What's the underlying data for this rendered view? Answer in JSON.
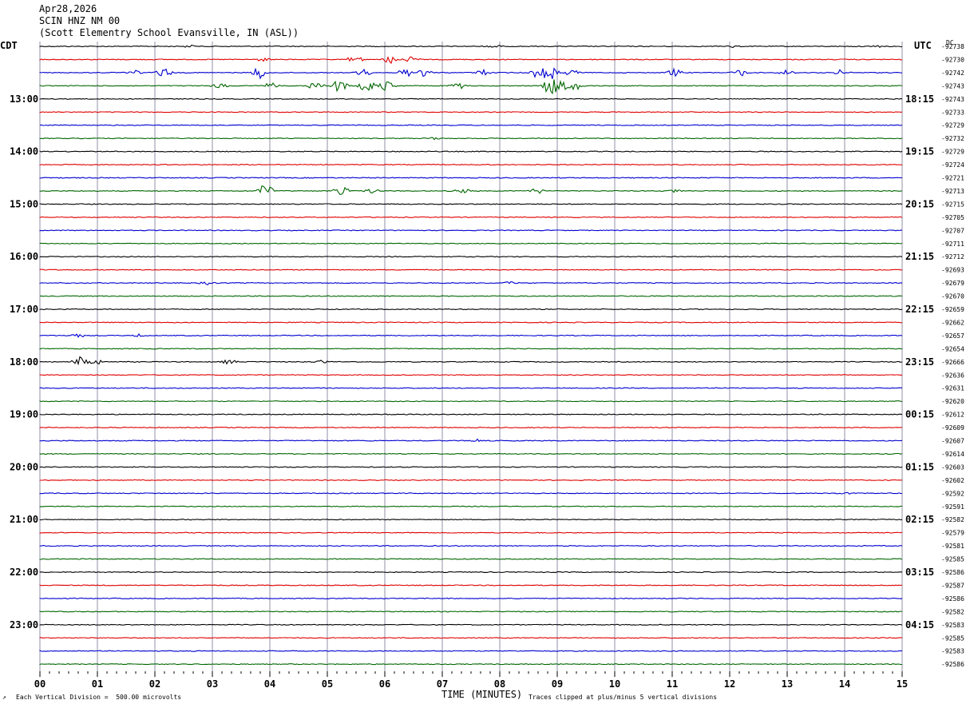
{
  "header": {
    "date": "Apr28,2026",
    "station": "SCIN HNZ NM 00",
    "location": "(Scott Elementry School Evansville, IN (ASL))"
  },
  "chart_data": {
    "type": "line",
    "left_zone_label": "CDT",
    "right_zone_label": "UTC",
    "dc_label": "DC",
    "xlabel": "TIME (MINUTES)",
    "x_ticks": [
      "00",
      "01",
      "02",
      "03",
      "04",
      "05",
      "06",
      "07",
      "08",
      "09",
      "10",
      "11",
      "12",
      "13",
      "14",
      "15"
    ],
    "left_hour_labels": [
      "13:00",
      "14:00",
      "15:00",
      "16:00",
      "17:00",
      "18:00",
      "19:00",
      "20:00",
      "21:00",
      "22:00",
      "23:00"
    ],
    "right_hour_labels": [
      "18:15",
      "19:15",
      "20:15",
      "21:15",
      "22:15",
      "23:15",
      "00:15",
      "01:15",
      "02:15",
      "03:15",
      "04:15"
    ],
    "trace_colors": [
      "#000000",
      "#e00000",
      "#0000d0",
      "#006600"
    ],
    "dc_offsets": [
      "-92738",
      "-92730",
      "-92742",
      "-92743",
      "-92743",
      "-92733",
      "-92729",
      "-92732",
      "-92729",
      "-92724",
      "-92721",
      "-92713",
      "-92715",
      "-92705",
      "-92707",
      "-92711",
      "-92712",
      "-92693",
      "-92679",
      "-92670",
      "-92659",
      "-92662",
      "-92657",
      "-92654",
      "-92666",
      "-92636",
      "-92631",
      "-92620",
      "-92612",
      "-92609",
      "-92607",
      "-92614",
      "-92603",
      "-92602",
      "-92592",
      "-92591",
      "-92582",
      "-92579",
      "-92581",
      "-92585",
      "-92586",
      "-92587",
      "-92586",
      "-92582",
      "-92583",
      "-92585",
      "-92583",
      "-92586"
    ],
    "notes": {
      "scale": "Each Vertical Division =  500.00 microvolts",
      "clip": "Traces clipped at plus/minus 5 vertical divisions"
    }
  }
}
